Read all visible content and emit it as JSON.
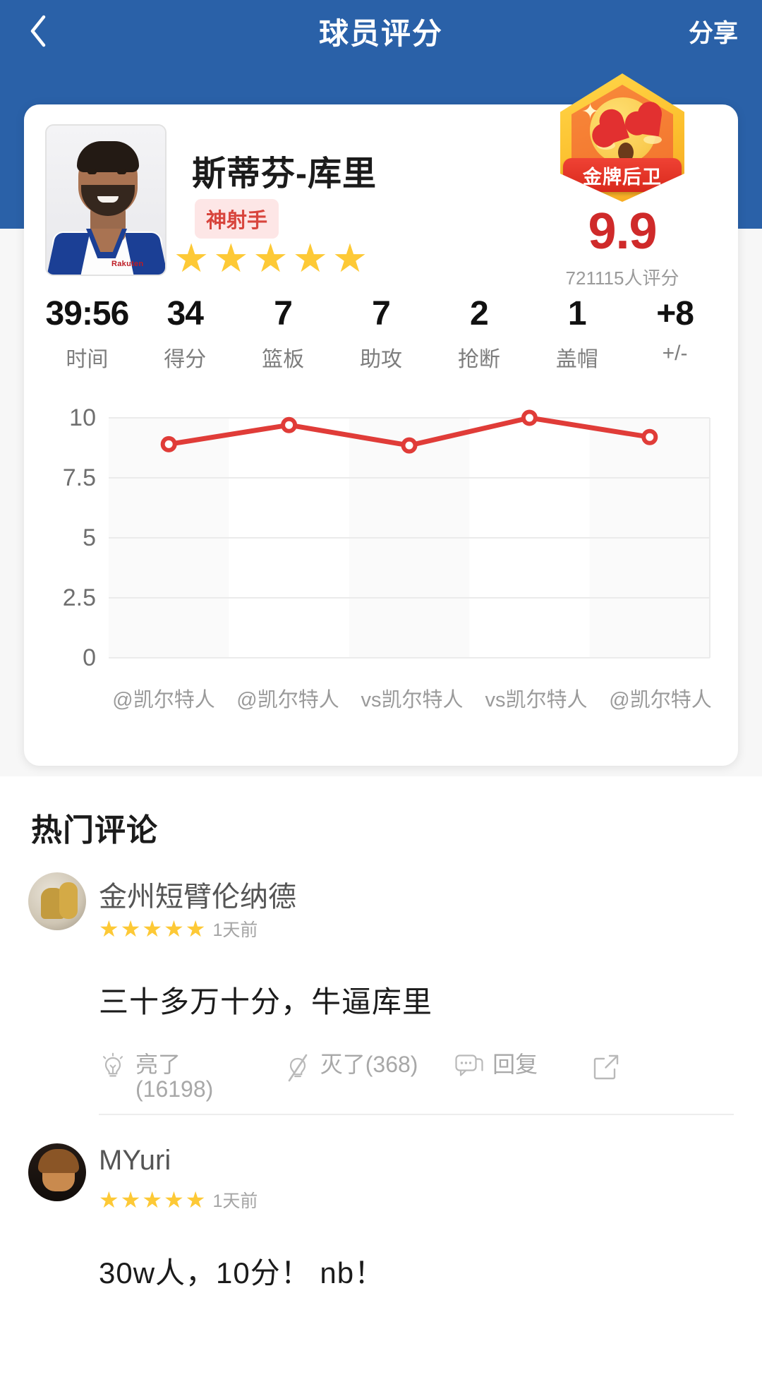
{
  "header": {
    "back_icon": "chevron-left-icon",
    "title": "球员评分",
    "share_label": "分享"
  },
  "player": {
    "name": "斯蒂芬-库里",
    "tag": "神射手",
    "star_glyph": "★",
    "star_count": 5,
    "avatar_jersey_logo": "Rakuten"
  },
  "badge": {
    "ribbon_label": "金牌后卫",
    "emoji": "heart-eyes-face",
    "sparkle_glyph": "✦"
  },
  "score": {
    "value": "9.9",
    "count_text": "721115人评分"
  },
  "stats": [
    {
      "value": "39:56",
      "label": "时间"
    },
    {
      "value": "34",
      "label": "得分"
    },
    {
      "value": "7",
      "label": "篮板"
    },
    {
      "value": "7",
      "label": "助攻"
    },
    {
      "value": "2",
      "label": "抢断"
    },
    {
      "value": "1",
      "label": "盖帽"
    },
    {
      "value": "+8",
      "label": "+/-"
    }
  ],
  "chart_data": {
    "type": "line",
    "title": "",
    "xlabel": "",
    "ylabel": "",
    "ylim": [
      0,
      10
    ],
    "yticks": [
      "10",
      "7.5",
      "5",
      "2.5",
      "0"
    ],
    "ytick_values": [
      10,
      7.5,
      5,
      2.5,
      0
    ],
    "grid": true,
    "legend": "none",
    "line_color": "#e03c38",
    "marker": "open-circle",
    "categories": [
      "@凯尔特人",
      "@凯尔特人",
      "vs凯尔特人",
      "vs凯尔特人",
      "@凯尔特人"
    ],
    "values": [
      8.9,
      9.7,
      8.85,
      10.0,
      9.2
    ]
  },
  "comments_section": {
    "title": "热门评论"
  },
  "comments": [
    {
      "name": "金州短臂伦纳德",
      "avatar": "avatar-trophy-photo",
      "stars": 5,
      "time": "1天前",
      "text": "三十多万十分，牛逼库里",
      "like_label": "亮了",
      "like_count": "(16198)",
      "dislike_label": "灭了(368)",
      "reply_label": "回复",
      "share_icon": "external-share-icon"
    },
    {
      "name": "MYuri",
      "avatar": "avatar-portrait-photo",
      "stars": 5,
      "time": "1天前",
      "text": "30w人，10分！ nb！"
    }
  ],
  "colors": {
    "header_blue": "#2a61a8",
    "accent_red": "#cf2a2a",
    "star_gold": "#fdc936",
    "tag_red": "#d8453d",
    "chart_line": "#e03c38"
  }
}
